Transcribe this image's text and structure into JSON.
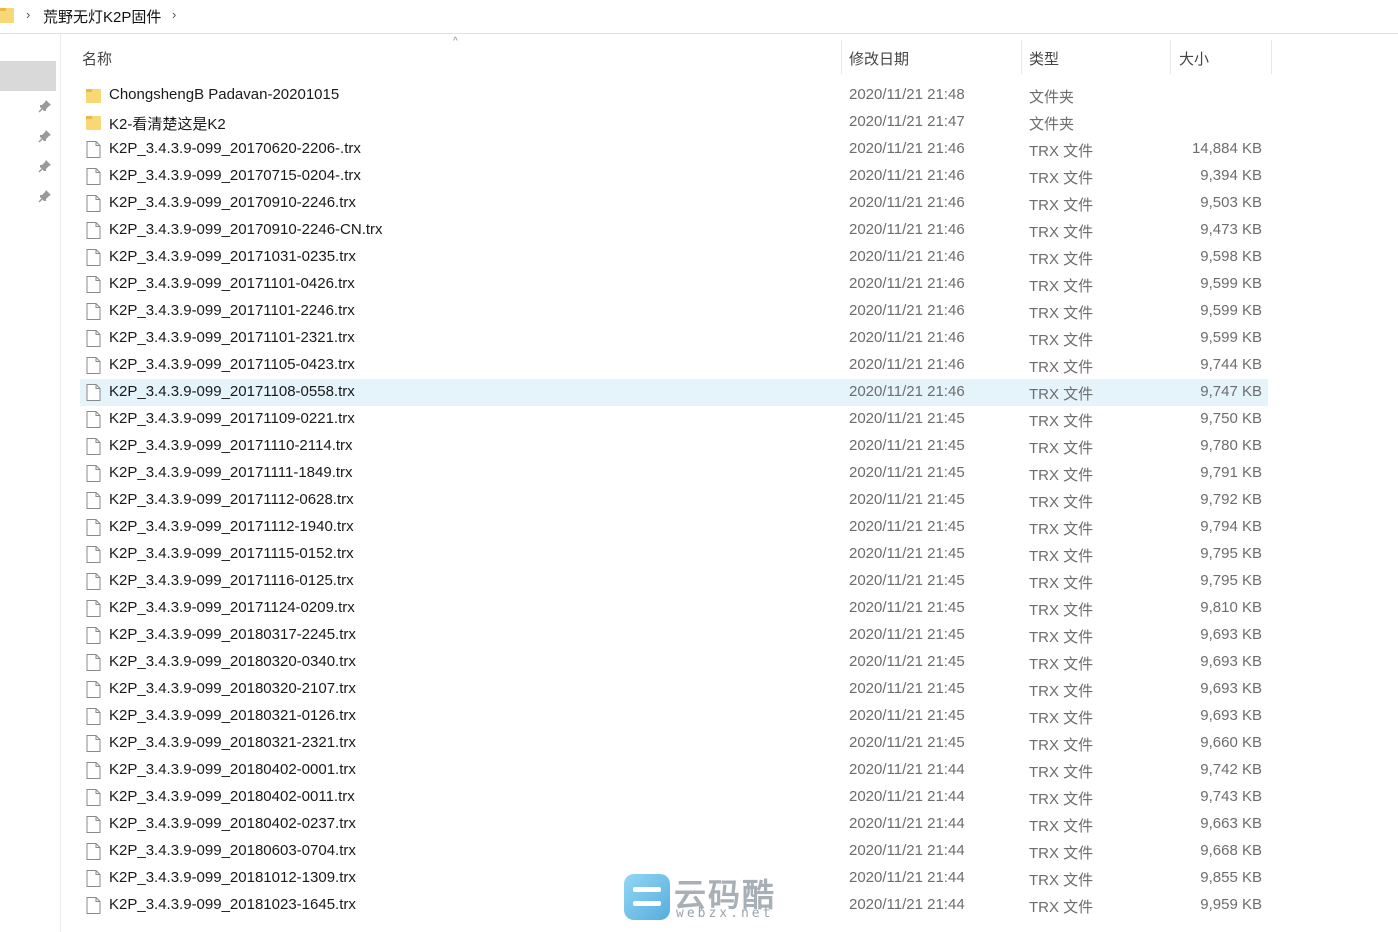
{
  "address_bar": {
    "chevron_left": "›",
    "path": "荒野无灯K2P固件",
    "chevron_right": "›",
    "folder_icon": "folder-icon"
  },
  "columns": {
    "name": "名称",
    "date": "修改日期",
    "type": "类型",
    "size": "大小",
    "sort_indicator": "^"
  },
  "nav": {
    "pin_icons": [
      "pin-icon",
      "pin-icon",
      "pin-icon",
      "pin-icon"
    ]
  },
  "colors": {
    "selected_row": "#e5f3fb",
    "folder_yellow": "#f8d775",
    "text_secondary": "#6d6d6d"
  },
  "files": [
    {
      "name": "ChongshengB Padavan-20201015",
      "date": "2020/11/21 21:48",
      "type": "文件夹",
      "size": "",
      "kind": "folder"
    },
    {
      "name": "K2-看清楚这是K2",
      "date": "2020/11/21 21:47",
      "type": "文件夹",
      "size": "",
      "kind": "folder"
    },
    {
      "name": "K2P_3.4.3.9-099_20170620-2206-.trx",
      "date": "2020/11/21 21:46",
      "type": "TRX 文件",
      "size": "14,884 KB",
      "kind": "file"
    },
    {
      "name": "K2P_3.4.3.9-099_20170715-0204-.trx",
      "date": "2020/11/21 21:46",
      "type": "TRX 文件",
      "size": "9,394 KB",
      "kind": "file"
    },
    {
      "name": "K2P_3.4.3.9-099_20170910-2246.trx",
      "date": "2020/11/21 21:46",
      "type": "TRX 文件",
      "size": "9,503 KB",
      "kind": "file"
    },
    {
      "name": "K2P_3.4.3.9-099_20170910-2246-CN.trx",
      "date": "2020/11/21 21:46",
      "type": "TRX 文件",
      "size": "9,473 KB",
      "kind": "file"
    },
    {
      "name": "K2P_3.4.3.9-099_20171031-0235.trx",
      "date": "2020/11/21 21:46",
      "type": "TRX 文件",
      "size": "9,598 KB",
      "kind": "file"
    },
    {
      "name": "K2P_3.4.3.9-099_20171101-0426.trx",
      "date": "2020/11/21 21:46",
      "type": "TRX 文件",
      "size": "9,599 KB",
      "kind": "file"
    },
    {
      "name": "K2P_3.4.3.9-099_20171101-2246.trx",
      "date": "2020/11/21 21:46",
      "type": "TRX 文件",
      "size": "9,599 KB",
      "kind": "file"
    },
    {
      "name": "K2P_3.4.3.9-099_20171101-2321.trx",
      "date": "2020/11/21 21:46",
      "type": "TRX 文件",
      "size": "9,599 KB",
      "kind": "file"
    },
    {
      "name": "K2P_3.4.3.9-099_20171105-0423.trx",
      "date": "2020/11/21 21:46",
      "type": "TRX 文件",
      "size": "9,744 KB",
      "kind": "file"
    },
    {
      "name": "K2P_3.4.3.9-099_20171108-0558.trx",
      "date": "2020/11/21 21:46",
      "type": "TRX 文件",
      "size": "9,747 KB",
      "kind": "file",
      "selected": true
    },
    {
      "name": "K2P_3.4.3.9-099_20171109-0221.trx",
      "date": "2020/11/21 21:45",
      "type": "TRX 文件",
      "size": "9,750 KB",
      "kind": "file"
    },
    {
      "name": "K2P_3.4.3.9-099_20171110-2114.trx",
      "date": "2020/11/21 21:45",
      "type": "TRX 文件",
      "size": "9,780 KB",
      "kind": "file"
    },
    {
      "name": "K2P_3.4.3.9-099_20171111-1849.trx",
      "date": "2020/11/21 21:45",
      "type": "TRX 文件",
      "size": "9,791 KB",
      "kind": "file"
    },
    {
      "name": "K2P_3.4.3.9-099_20171112-0628.trx",
      "date": "2020/11/21 21:45",
      "type": "TRX 文件",
      "size": "9,792 KB",
      "kind": "file"
    },
    {
      "name": "K2P_3.4.3.9-099_20171112-1940.trx",
      "date": "2020/11/21 21:45",
      "type": "TRX 文件",
      "size": "9,794 KB",
      "kind": "file"
    },
    {
      "name": "K2P_3.4.3.9-099_20171115-0152.trx",
      "date": "2020/11/21 21:45",
      "type": "TRX 文件",
      "size": "9,795 KB",
      "kind": "file"
    },
    {
      "name": "K2P_3.4.3.9-099_20171116-0125.trx",
      "date": "2020/11/21 21:45",
      "type": "TRX 文件",
      "size": "9,795 KB",
      "kind": "file"
    },
    {
      "name": "K2P_3.4.3.9-099_20171124-0209.trx",
      "date": "2020/11/21 21:45",
      "type": "TRX 文件",
      "size": "9,810 KB",
      "kind": "file"
    },
    {
      "name": "K2P_3.4.3.9-099_20180317-2245.trx",
      "date": "2020/11/21 21:45",
      "type": "TRX 文件",
      "size": "9,693 KB",
      "kind": "file"
    },
    {
      "name": "K2P_3.4.3.9-099_20180320-0340.trx",
      "date": "2020/11/21 21:45",
      "type": "TRX 文件",
      "size": "9,693 KB",
      "kind": "file"
    },
    {
      "name": "K2P_3.4.3.9-099_20180320-2107.trx",
      "date": "2020/11/21 21:45",
      "type": "TRX 文件",
      "size": "9,693 KB",
      "kind": "file"
    },
    {
      "name": "K2P_3.4.3.9-099_20180321-0126.trx",
      "date": "2020/11/21 21:45",
      "type": "TRX 文件",
      "size": "9,693 KB",
      "kind": "file"
    },
    {
      "name": "K2P_3.4.3.9-099_20180321-2321.trx",
      "date": "2020/11/21 21:45",
      "type": "TRX 文件",
      "size": "9,660 KB",
      "kind": "file"
    },
    {
      "name": "K2P_3.4.3.9-099_20180402-0001.trx",
      "date": "2020/11/21 21:44",
      "type": "TRX 文件",
      "size": "9,742 KB",
      "kind": "file"
    },
    {
      "name": "K2P_3.4.3.9-099_20180402-0011.trx",
      "date": "2020/11/21 21:44",
      "type": "TRX 文件",
      "size": "9,743 KB",
      "kind": "file"
    },
    {
      "name": "K2P_3.4.3.9-099_20180402-0237.trx",
      "date": "2020/11/21 21:44",
      "type": "TRX 文件",
      "size": "9,663 KB",
      "kind": "file"
    },
    {
      "name": "K2P_3.4.3.9-099_20180603-0704.trx",
      "date": "2020/11/21 21:44",
      "type": "TRX 文件",
      "size": "9,668 KB",
      "kind": "file"
    },
    {
      "name": "K2P_3.4.3.9-099_20181012-1309.trx",
      "date": "2020/11/21 21:44",
      "type": "TRX 文件",
      "size": "9,855 KB",
      "kind": "file"
    },
    {
      "name": "K2P_3.4.3.9-099_20181023-1645.trx",
      "date": "2020/11/21 21:44",
      "type": "TRX 文件",
      "size": "9,959 KB",
      "kind": "file"
    }
  ],
  "watermark": {
    "cn": "云码酷",
    "en": "webzx.net"
  }
}
